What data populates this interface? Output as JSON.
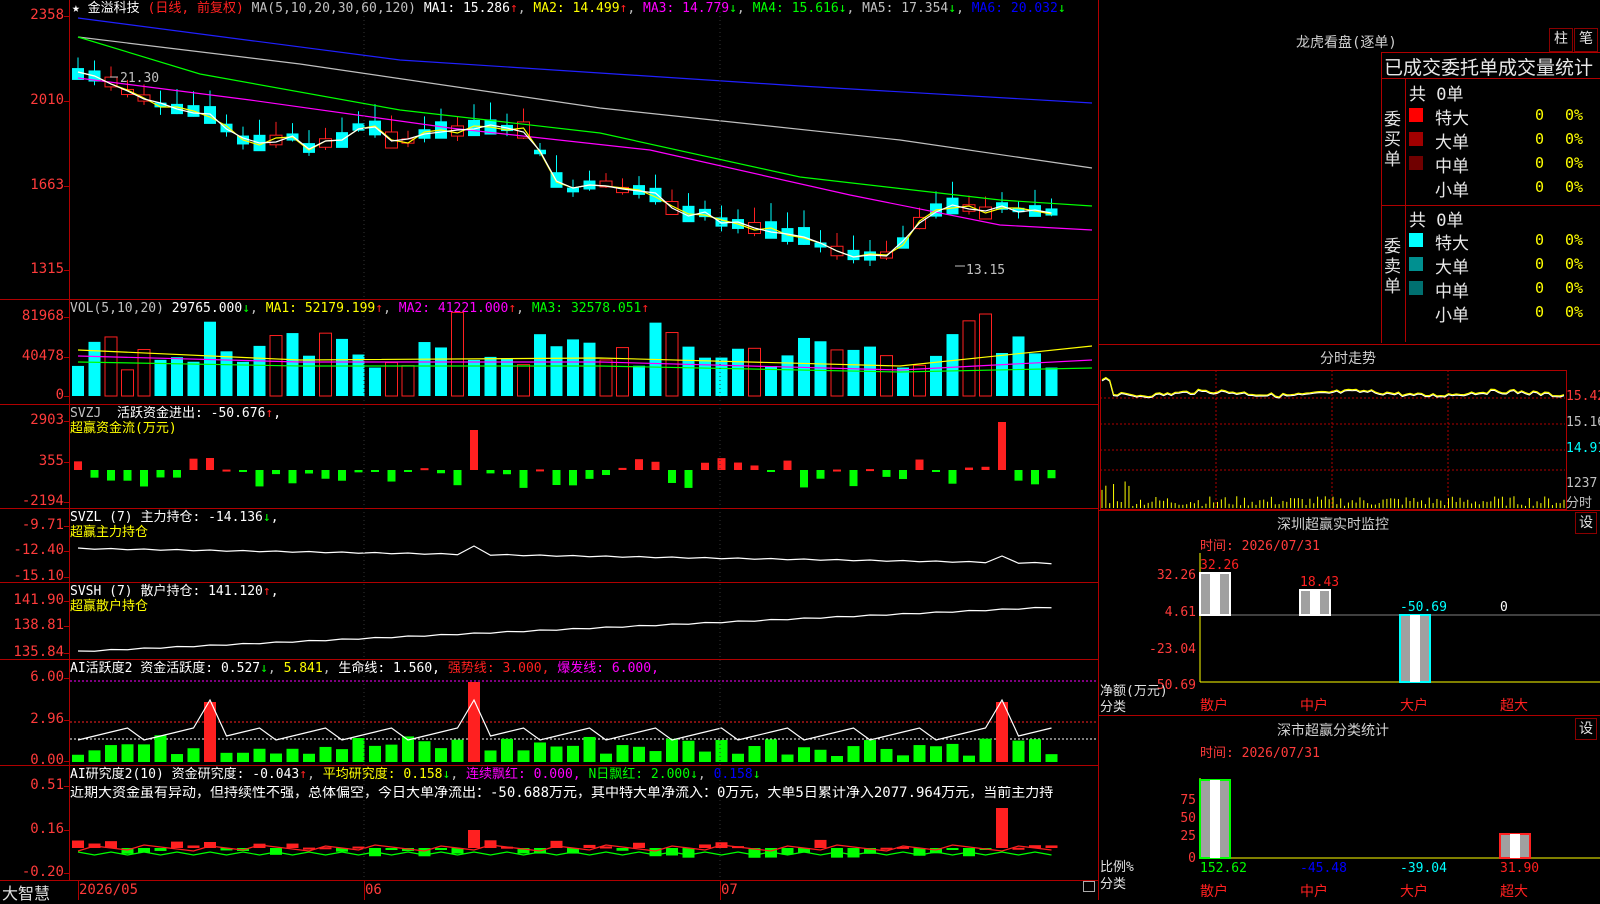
{
  "main_chart": {
    "star": "★",
    "stock_name": "金溢科技",
    "period": "(日线, 前复权)",
    "ma_header": "MA(5,10,20,30,60,120)",
    "ma": [
      {
        "label": "MA1: 15.286",
        "arrow": "↑",
        "color": "#ffffff"
      },
      {
        "label": "MA2: 14.499",
        "arrow": "↑",
        "color": "#ffff00"
      },
      {
        "label": "MA3: 14.779",
        "arrow": "↓",
        "color": "#ff00ff"
      },
      {
        "label": "MA4: 15.616",
        "arrow": "↓",
        "color": "#00ff00"
      },
      {
        "label": "MA5: 17.354",
        "arrow": "↓",
        "color": "#c0c0c0"
      },
      {
        "label": "MA6: 20.032",
        "arrow": "↓",
        "color": "#0000ff"
      }
    ],
    "y_ticks": [
      "2358",
      "2010",
      "1663",
      "1315"
    ],
    "high_label": "21.30",
    "low_label": "13.15"
  },
  "vol": {
    "header": "VOL(5,10,20)",
    "value": "29765.000",
    "value_arrow": "↓",
    "ma": [
      {
        "label": "MA1: 52179.199",
        "arrow": "↑",
        "color": "#ffff00"
      },
      {
        "label": "MA2: 41221.000",
        "arrow": "↑",
        "color": "#ff00ff"
      },
      {
        "label": "MA3: 32578.051",
        "arrow": "↑",
        "color": "#00ff00"
      }
    ],
    "y_ticks": [
      "81968",
      "40478",
      "0"
    ]
  },
  "svzj": {
    "header": "SVZJ",
    "line1": "活跃资金进出: -50.676",
    "line1_arrow": "↑",
    "line1_tail": ",",
    "line2": "超赢资金流(万元)",
    "y_ticks": [
      "2903",
      "355",
      "-2194"
    ]
  },
  "svzl": {
    "header": "SVZL (7) 主力持仓: -14.136",
    "arrow": "↓",
    "tail": ",",
    "line2": "超赢主力持仓",
    "y_ticks": [
      "-9.71",
      "-12.40",
      "-15.10"
    ]
  },
  "svsh": {
    "header": "SVSH (7) 散户持仓: 141.120",
    "arrow": "↑",
    "tail": ",",
    "line2": "超赢散户持仓",
    "y_ticks": [
      "141.90",
      "138.81",
      "135.84"
    ]
  },
  "ai_active": {
    "p1": "AI活跃度2 资金活跃度: 0.527",
    "p1_arrow": "↓",
    "p2": "5.841",
    "p3": "生命线: 1.560,",
    "p4": "强势线: 3.000,",
    "p5": "爆发线: 6.000,",
    "y_ticks": [
      "6.00",
      "2.96",
      "0.00"
    ]
  },
  "ai_research": {
    "p1": "AI研究度2(10) 资金研究度: -0.043",
    "p1_arrow": "↑",
    "p2": "平均研究度: 0.158",
    "p2_arrow": "↓",
    "p3": "连续飘红: 0.000,",
    "p4": "N日飘红: 2.000",
    "p4_arrow": "↓",
    "p5": "0.158",
    "p5_arrow": "↓",
    "comment": "近期大资金虽有异动，但持续性不强，总体偏空，今日大单净流出：-50.688万元，其中特大单净流入：0万元，大单5日累计净入2077.964万元，当前主力持",
    "y_ticks": [
      "0.51",
      "0.16",
      "-0.20"
    ]
  },
  "bottom_bar": {
    "brand": "大智慧",
    "dates": [
      "2026/05",
      "06",
      "07"
    ]
  },
  "right_panel": {
    "dragon_title": "龙虎看盘(逐单)",
    "btn_bar": "柱",
    "btn_pen": "笔",
    "stats_title": "已成交委托单成交量统计",
    "buy": {
      "side_label": "委买单",
      "total": "共 0单",
      "rows": [
        {
          "label": "特大",
          "num": "0",
          "pct": "0%",
          "color": "#ff0000"
        },
        {
          "label": "大单",
          "num": "0",
          "pct": "0%",
          "color": "#a00000"
        },
        {
          "label": "中单",
          "num": "0",
          "pct": "0%",
          "color": "#700000"
        },
        {
          "label": "小单",
          "num": "0",
          "pct": "0%",
          "color": "#000000"
        }
      ]
    },
    "sell": {
      "side_label": "委卖单",
      "total": "共 0单",
      "rows": [
        {
          "label": "特大",
          "num": "0",
          "pct": "0%",
          "color": "#00ffff"
        },
        {
          "label": "大单",
          "num": "0",
          "pct": "0%",
          "color": "#009090"
        },
        {
          "label": "中单",
          "num": "0",
          "pct": "0%",
          "color": "#007070"
        },
        {
          "label": "小单",
          "num": "0",
          "pct": "0%",
          "color": "#000000"
        }
      ]
    },
    "intraday": {
      "title": "分时走势",
      "prices": [
        "15.42",
        "15.16",
        "14.91"
      ],
      "vol_label": "1237",
      "vol_unit": "分时"
    },
    "monitor": {
      "title": "深圳超赢实时监控",
      "setting": "设",
      "time": "时间: 2026/07/31",
      "y_ticks": [
        "32.26",
        "4.61",
        "-23.04",
        "-50.69"
      ],
      "unit": "净额(万元)",
      "category": "分类",
      "cats": [
        "散户",
        "中户",
        "大户",
        "超大"
      ],
      "values": [
        "32.26",
        "18.43",
        "-50.69",
        "0"
      ]
    },
    "classify": {
      "title": "深市超赢分类统计",
      "setting": "设",
      "time": "时间: 2026/07/31",
      "y_ticks": [
        "75",
        "50",
        "25",
        "0"
      ],
      "unit": "比例%",
      "category": "分类",
      "cats": [
        "散户",
        "中户",
        "大户",
        "超大"
      ],
      "values": [
        "152.62",
        "-45.48",
        "-39.04",
        "31.90"
      ]
    }
  },
  "colors": {
    "up": "#ff2020",
    "down": "#00ffff",
    "grid": "#b00000",
    "axis": "#ff3b3b"
  }
}
